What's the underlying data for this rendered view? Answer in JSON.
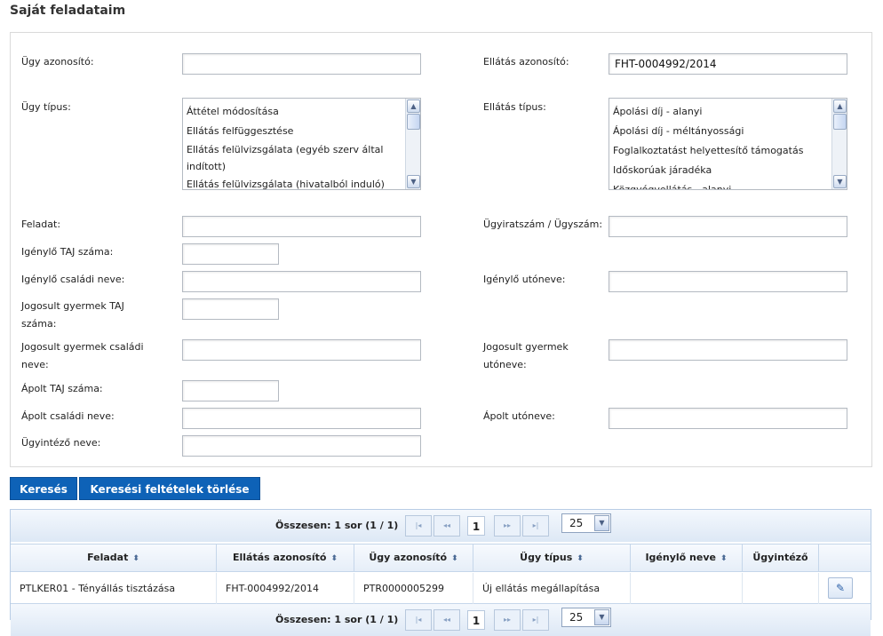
{
  "page": {
    "title": "Saját feladataim"
  },
  "form": {
    "ugy_azonosito": {
      "label": "Ügy azonosító:",
      "value": ""
    },
    "ellatas_azonosito": {
      "label": "Ellátás azonosító:",
      "value": "FHT-0004992/2014"
    },
    "ugy_tipus": {
      "label": "Ügy típus:",
      "options": [
        "Áttétel módosítása",
        "Ellátás felfüggesztése",
        "Ellátás felülvizsgálata (egyéb szerv által indított)",
        "Ellátás felülvizsgálata (hivatalból induló)"
      ]
    },
    "ellatas_tipus": {
      "label": "Ellátás típus:",
      "options": [
        "Ápolási díj - alanyi",
        "Ápolási díj - méltányossági",
        "Foglalkoztatást helyettesítő támogatás",
        "Időskorúak járadéka",
        "Közgyógyellátás - alanyi"
      ]
    },
    "feladat": {
      "label": "Feladat:",
      "value": ""
    },
    "ugyiratszam": {
      "label": "Ügyiratszám / Ügyszám:",
      "value": ""
    },
    "igenylo_taj": {
      "label": "Igénylő TAJ száma:",
      "value": ""
    },
    "igenylo_csaladi": {
      "label": "Igénylő családi neve:",
      "value": ""
    },
    "igenylo_uto": {
      "label": "Igénylő utóneve:",
      "value": ""
    },
    "jogosult_taj": {
      "label_line1": "Jogosult gyermek TAJ",
      "label_line2": "száma:",
      "value": ""
    },
    "jogosult_csaladi": {
      "label_line1": "Jogosult gyermek családi",
      "label_line2": "neve:",
      "value": ""
    },
    "jogosult_uto": {
      "label_line1": "Jogosult gyermek",
      "label_line2": "utóneve:",
      "value": ""
    },
    "apolt_taj": {
      "label": "Ápolt TAJ száma:",
      "value": ""
    },
    "apolt_csaladi": {
      "label": "Ápolt családi neve:",
      "value": ""
    },
    "apolt_uto": {
      "label": "Ápolt utóneve:",
      "value": ""
    },
    "ugyintezo": {
      "label": "Ügyintéző neve:",
      "value": ""
    }
  },
  "buttons": {
    "search": "Keresés",
    "clear": "Keresési feltételek törlése"
  },
  "pager": {
    "total": "Összesen: 1 sor (1 / 1)",
    "first": "|◂",
    "prev": "◂◂",
    "current_page": "1",
    "next": "▸▸",
    "last": "▸|",
    "page_size": "25"
  },
  "table": {
    "columns": [
      "Feladat",
      "Ellátás azonosító",
      "Ügy azonosító",
      "Ügy típus",
      "Igénylő neve",
      "Ügyintéző"
    ],
    "sort_icon": "⬍",
    "rows": [
      {
        "feladat": "PTLKER01 - Tényállás tisztázása",
        "ellatas_azonosito": "FHT-0004992/2014",
        "ugy_azonosito": "PTR0000005299",
        "ugy_tipus": "Új ellátás megállapítása",
        "igenylo_neve": "",
        "ugyintezo": ""
      }
    ]
  },
  "icons": {
    "scroll_up": "▲",
    "scroll_down": "▼",
    "dropdown": "▼",
    "edit": "✎"
  }
}
